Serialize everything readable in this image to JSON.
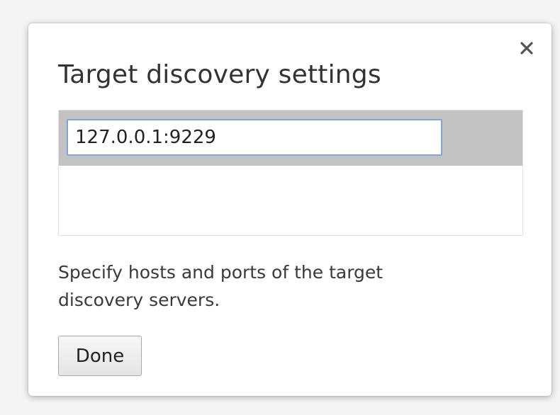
{
  "dialog": {
    "title": "Target discovery settings",
    "close_icon": "close-icon",
    "hosts": [
      {
        "value": "127.0.0.1:9229"
      }
    ],
    "hint": "Specify hosts and ports of the target discovery servers.",
    "done_label": "Done"
  },
  "colors": {
    "selected_row": "#c2c2c2",
    "input_focus_border": "#7fa6d8"
  }
}
